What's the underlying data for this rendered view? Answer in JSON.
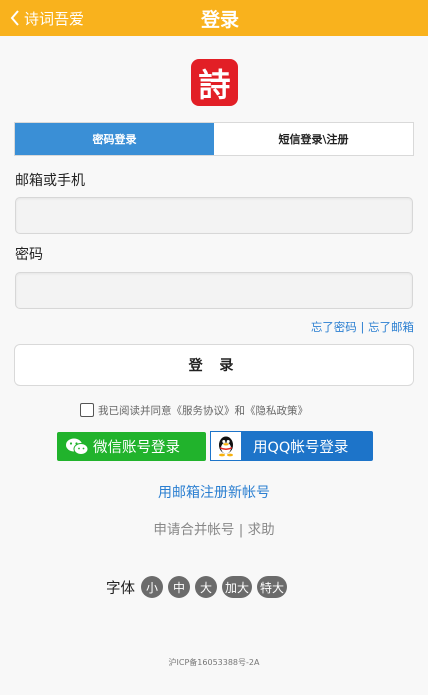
{
  "header": {
    "back_label": "诗词吾爱",
    "title": "登录"
  },
  "logo": {
    "char": "詩",
    "color": "#e21f26"
  },
  "tabs": [
    {
      "label": "密码登录",
      "active": true
    },
    {
      "label": "短信登录\\注册",
      "active": false
    }
  ],
  "form": {
    "account_label": "邮箱或手机",
    "account_value": "",
    "password_label": "密码",
    "password_value": ""
  },
  "links": {
    "forgot_password": "忘了密码",
    "separator": "|",
    "forgot_email": "忘了邮箱"
  },
  "login_button": "登 录",
  "agreement": {
    "prefix": "我已阅读并同意",
    "service": "《服务协议》",
    "and": "和",
    "privacy": "《隐私政策》",
    "checked": false
  },
  "social": {
    "wechat_label": "微信账号登录",
    "qq_label": "用QQ帐号登录"
  },
  "register_link": "用邮箱注册新帐号",
  "merge": {
    "merge_label": "申请合并帐号",
    "separator": "|",
    "help_label": "求助"
  },
  "font_size": {
    "label": "字体",
    "options": [
      "小",
      "中",
      "大",
      "加大",
      "特大"
    ]
  },
  "footer": "沪ICP备16053388号-2A",
  "colors": {
    "header": "#f9b21d",
    "tab_active": "#3a8fd6",
    "link": "#2b7fd1",
    "wechat": "#21b32c",
    "qq": "#1d74c9"
  }
}
